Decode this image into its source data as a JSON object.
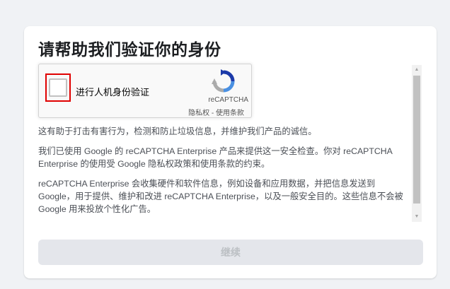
{
  "page": {
    "title": "请帮助我们验证你的身份"
  },
  "recaptcha": {
    "checkbox_label": "进行人机身份验证",
    "brand": "reCAPTCHA",
    "privacy_link": "隐私权",
    "separator": " - ",
    "terms_link": "使用条款",
    "logo_icon": "recaptcha-logo-icon",
    "highlight_color": "#e00000"
  },
  "info": {
    "paragraphs": [
      "这有助于打击有害行为，检测和防止垃圾信息，并维护我们产品的诚信。",
      "我们已使用 Google 的 reCAPTCHA Enterprise 产品来提供这一安全检查。你对 reCAPTCHA Enterprise 的使用受 Google 隐私权政策和使用条款的约束。",
      "reCAPTCHA Enterprise 会收集硬件和软件信息，例如设备和应用数据，并把信息发送到 Google，用于提供、维护和改进 reCAPTCHA Enterprise，以及一般安全目的。这些信息不会被 Google 用来投放个性化广告。"
    ]
  },
  "scrollbar": {
    "up_icon": "▲",
    "down_icon": "▼"
  },
  "actions": {
    "continue_label": "继续",
    "continue_disabled": true
  },
  "colors": {
    "background": "#f0f2f5",
    "card": "#ffffff",
    "button_disabled_bg": "#e4e6eb",
    "button_disabled_text": "#bcc0c4"
  }
}
